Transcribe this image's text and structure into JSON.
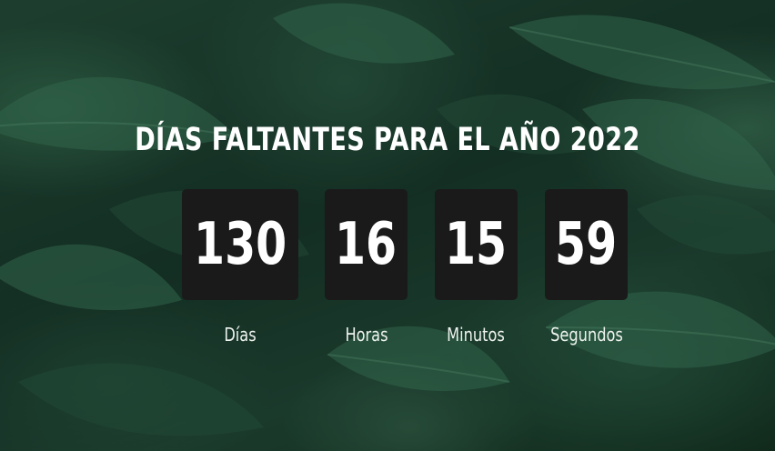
{
  "title": "DÍAS FALTANTES PARA EL AÑO 2022",
  "countdown": [
    {
      "value": "130",
      "label": "Días"
    },
    {
      "value": "16",
      "label": "Horas"
    },
    {
      "value": "15",
      "label": "Minutos"
    },
    {
      "value": "59",
      "label": "Segundos"
    }
  ],
  "colors": {
    "box_background": "#1a1a1a",
    "text": "#ffffff",
    "background": "#1c3d2e"
  },
  "background_image": "green leaves with water droplets"
}
